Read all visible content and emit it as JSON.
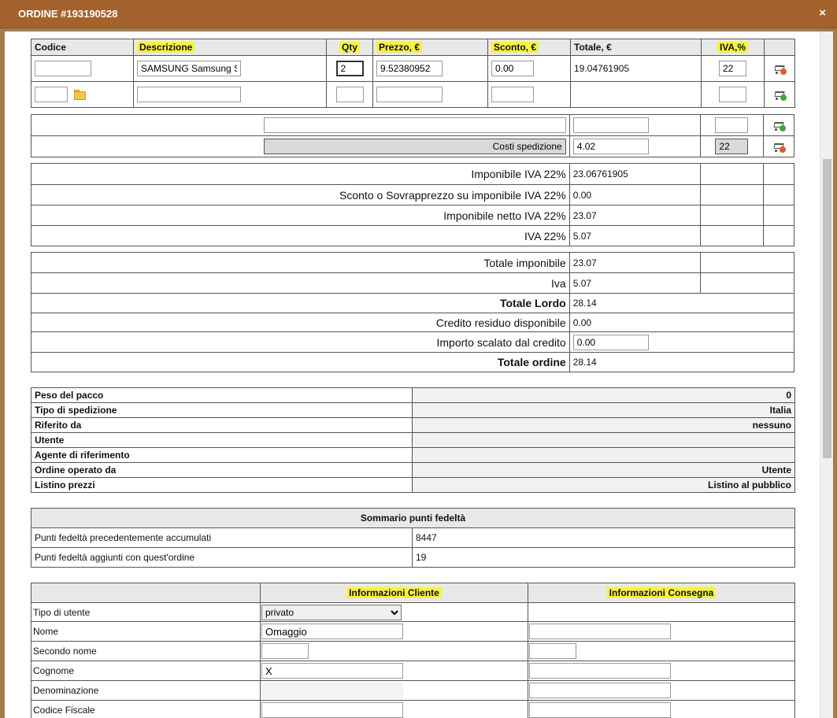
{
  "window": {
    "title": "ORDINE #193190528",
    "close_glyph": "×"
  },
  "items": {
    "headers": {
      "codice": "Codice",
      "descrizione": "Descrizione",
      "qty": "Qty",
      "prezzo": "Prezzo, €",
      "sconto": "Sconto, €",
      "totale": "Totale, €",
      "iva": "IVA,%"
    },
    "row1": {
      "codice": "",
      "descrizione": "SAMSUNG Samsung S",
      "qty": "2",
      "prezzo": "9.52380952",
      "sconto": "0.00",
      "totale": "19.04761905",
      "iva": "22"
    },
    "row2": {
      "codice": "",
      "descrizione": "",
      "qty": "",
      "prezzo": "",
      "sconto": "",
      "iva": ""
    }
  },
  "extra": {
    "row1": {
      "desc": "",
      "totale": "",
      "iva": ""
    },
    "shipping": {
      "label": "Costi spedizione",
      "totale": "4.02",
      "iva": "22"
    }
  },
  "summary": {
    "imponibile_label": "Imponibile IVA 22%",
    "imponibile_value": "23.06761905",
    "sconto_label": "Sconto o Sovrapprezzo su imponibile IVA 22%",
    "sconto_value": "0.00",
    "netto_label": "Imponibile netto IVA 22%",
    "netto_value": "23.07",
    "iva_label": "IVA 22%",
    "iva_value": "5.07"
  },
  "totals": {
    "tot_imponibile_label": "Totale imponibile",
    "tot_imponibile_value": "23.07",
    "iva_label": "Iva",
    "iva_value": "5.07",
    "lordo_label": "Totale Lordo",
    "lordo_value": "28.14",
    "credito_label": "Credito residuo disponibile",
    "credito_value": "0.00",
    "scalato_label": "Importo scalato dal credito",
    "scalato_value": "0.00",
    "ordine_label": "Totale ordine",
    "ordine_value": "28.14"
  },
  "info": [
    {
      "label": "Peso del pacco",
      "value": "0"
    },
    {
      "label": "Tipo di spedizione",
      "value": "Italia"
    },
    {
      "label": "Riferito da",
      "value": "nessuno"
    },
    {
      "label": "Utente",
      "value": ""
    },
    {
      "label": "Agente di riferimento",
      "value": ""
    },
    {
      "label": "Ordine operato da",
      "value": "Utente"
    },
    {
      "label": "Listino prezzi",
      "value": "Listino al pubblico"
    }
  ],
  "loyalty": {
    "title": "Sommario punti fedeltà",
    "prev_label": "Punti fedeltà precedentemente accumulati",
    "prev_value": "8447",
    "added_label": "Punti fedeltà aggiunti con quest'ordine",
    "added_value": "19"
  },
  "client": {
    "col_cliente": "Informazioni Cliente",
    "col_consegna": "Informazioni Consegna",
    "tipo_label": "Tipo di utente",
    "tipo_value": "privato",
    "nome_label": "Nome",
    "nome_value": "Omaggio",
    "secondo_label": "Secondo nome",
    "cognome_label": "Cognome",
    "cognome_value": "X",
    "denom_label": "Denominazione",
    "cf_label": "Codice Fiscale"
  }
}
